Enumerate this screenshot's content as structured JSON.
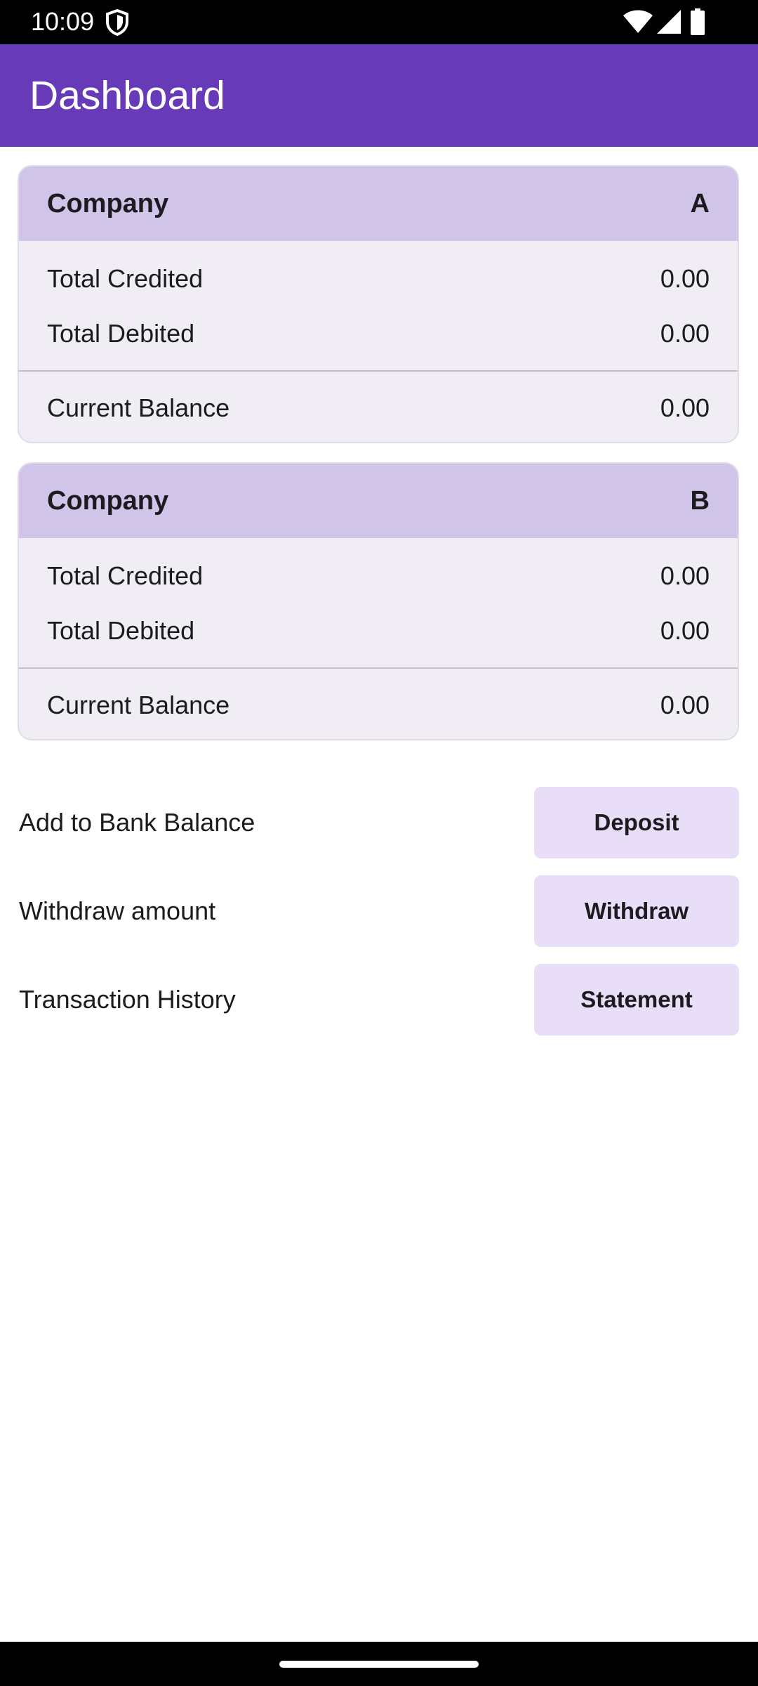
{
  "status_bar": {
    "time": "10:09"
  },
  "app_bar": {
    "title": "Dashboard",
    "background_color": "#673ab7"
  },
  "companies": [
    {
      "header_label": "Company",
      "header_value": "A",
      "rows": [
        {
          "label": "Total Credited",
          "value": "0.00"
        },
        {
          "label": "Total Debited",
          "value": "0.00"
        }
      ],
      "balance": {
        "label": "Current Balance",
        "value": "0.00"
      }
    },
    {
      "header_label": "Company",
      "header_value": "B",
      "rows": [
        {
          "label": "Total Credited",
          "value": "0.00"
        },
        {
          "label": "Total Debited",
          "value": "0.00"
        }
      ],
      "balance": {
        "label": "Current Balance",
        "value": "0.00"
      }
    }
  ],
  "actions": [
    {
      "label": "Add to Bank Balance",
      "button": "Deposit"
    },
    {
      "label": "Withdraw amount",
      "button": "Withdraw"
    },
    {
      "label": "Transaction History",
      "button": "Statement"
    }
  ],
  "icons": {
    "status": [
      "shield-icon",
      "wifi-icon",
      "signal-icon",
      "battery-icon"
    ]
  },
  "colors": {
    "card_header": "#d0c4e8",
    "card_body": "#f0edf5",
    "button": "#e8def8"
  }
}
